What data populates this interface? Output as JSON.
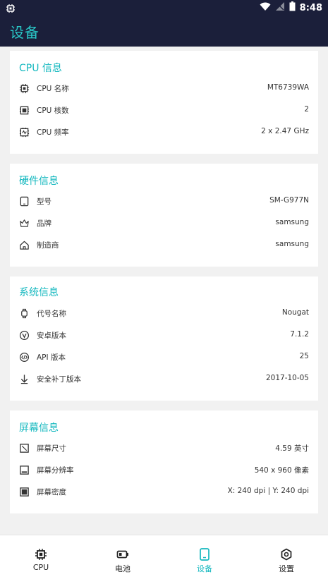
{
  "status": {
    "time": "8:48"
  },
  "app": {
    "title": "设备"
  },
  "colors": {
    "accent": "#14b8bf",
    "appbar": "#1b1f3a"
  },
  "cpu": {
    "title": "CPU 信息",
    "rows": [
      {
        "icon": "chip-icon",
        "label": "CPU 名称",
        "value": "MT6739WA"
      },
      {
        "icon": "cores-icon",
        "label": "CPU 核数",
        "value": "2"
      },
      {
        "icon": "frequency-icon",
        "label": "CPU 频率",
        "value": "2 x 2.47 GHz"
      }
    ]
  },
  "hardware": {
    "title": "硬件信息",
    "rows": [
      {
        "icon": "tablet-icon",
        "label": "型号",
        "value": "SM-G977N"
      },
      {
        "icon": "crown-icon",
        "label": "品牌",
        "value": "samsung"
      },
      {
        "icon": "home-icon",
        "label": "制造商",
        "value": "samsung"
      }
    ]
  },
  "system": {
    "title": "系统信息",
    "rows": [
      {
        "icon": "watch-icon",
        "label": "代号名称",
        "value": "Nougat"
      },
      {
        "icon": "android-version-icon",
        "label": "安卓版本",
        "value": "7.1.2"
      },
      {
        "icon": "api-icon",
        "label": "API 版本",
        "value": "25"
      },
      {
        "icon": "security-patch-icon",
        "label": "安全补丁版本",
        "value": "2017-10-05"
      }
    ]
  },
  "screen": {
    "title": "屏幕信息",
    "rows": [
      {
        "icon": "screen-size-icon",
        "label": "屏幕尺寸",
        "value": "4.59 英寸"
      },
      {
        "icon": "resolution-icon",
        "label": "屏幕分辨率",
        "value": "540 x 960 像素"
      },
      {
        "icon": "density-icon",
        "label": "屏幕密度",
        "value": "X: 240 dpi  |  Y: 240 dpi"
      }
    ]
  },
  "nav": {
    "items": [
      {
        "icon": "cpu-nav-icon",
        "label": "CPU",
        "active": false
      },
      {
        "icon": "battery-nav-icon",
        "label": "电池",
        "active": false
      },
      {
        "icon": "device-nav-icon",
        "label": "设备",
        "active": true
      },
      {
        "icon": "settings-nav-icon",
        "label": "设置",
        "active": false
      }
    ]
  }
}
